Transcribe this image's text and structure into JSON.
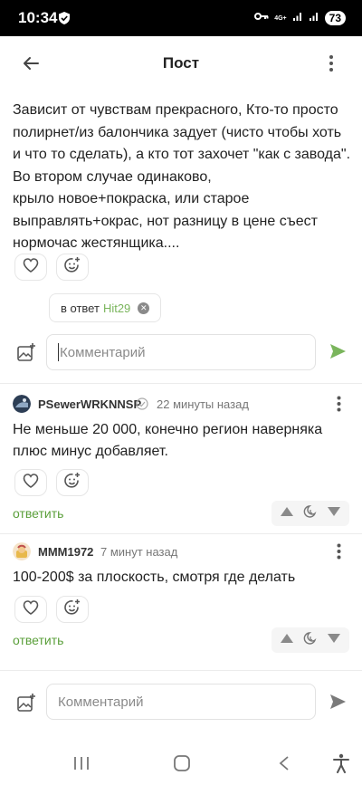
{
  "status": {
    "time": "10:34",
    "network": "4G+",
    "battery": "73"
  },
  "topbar": {
    "title": "Пост"
  },
  "post": {
    "lines": [
      "Зависит от чувствам прекрасного, Кто-то просто",
      "полирнет/из балончика задует (чисто чтобы хоть",
      "и что то сделать), а кто тот захочет \"как с завода\".",
      "Во втором случае одинаково,",
      "крыло новое+покраска, или старое",
      "выправлять+окрас, нот разницу в цене съест",
      "нормочас жестянщика...."
    ]
  },
  "reply_to": {
    "prefix": "в ответ",
    "user": "Hit29"
  },
  "reply_input": {
    "placeholder": "Комментарий"
  },
  "comments": [
    {
      "author": "PSewerWRKNNSP",
      "time": "22 минуты назад",
      "lines": [
        "Не меньше 20 000, конечно регион наверняка",
        "плюс минус добавляет."
      ],
      "reply_label": "ответить"
    },
    {
      "author": "MMM1972",
      "time": "7 минут назад",
      "lines": [
        "100-200$ за плоскость, смотря где делать"
      ],
      "reply_label": "ответить"
    }
  ],
  "bottom_input": {
    "placeholder": "Комментарий"
  },
  "icons": {
    "back": "arrow-left-icon",
    "more": "more-vertical-icon",
    "like": "heart-icon",
    "react": "emoji-add-icon",
    "image": "image-add-icon",
    "send": "send-icon",
    "up": "triangle-up-icon",
    "down": "triangle-down-icon",
    "save": "moon-clock-icon",
    "nav_recents": "recents-icon",
    "nav_home": "home-icon",
    "nav_back": "nav-back-icon",
    "accessibility": "accessibility-icon"
  },
  "colors": {
    "accent_green": "#5a9f3a",
    "send_active": "#7ab55c",
    "send_inactive": "#7a7a7a"
  }
}
